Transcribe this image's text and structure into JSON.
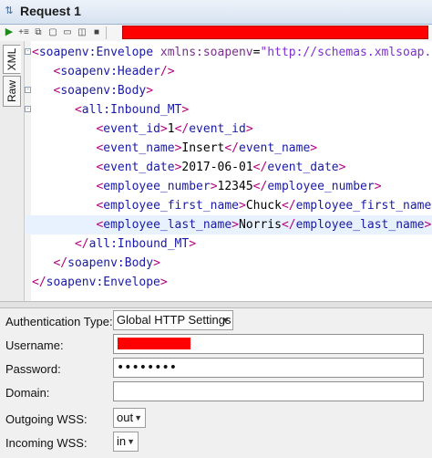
{
  "window": {
    "title": "Request 1",
    "app_icon": "soap-request-icon"
  },
  "toolbar": {
    "buttons": [
      "run-icon",
      "add-icon",
      "clone-icon",
      "format-icon",
      "close-icon",
      "options-icon",
      "stop-icon"
    ],
    "endpoint_redacted": true
  },
  "tabs": {
    "xml": "XML",
    "raw": "Raw",
    "active": "XML"
  },
  "editor": {
    "lines": [
      {
        "fold": "-",
        "segments": [
          {
            "c": "t",
            "s": "<"
          },
          {
            "c": "n",
            "s": "soapenv:Envelope"
          },
          {
            "c": "x",
            "s": " "
          },
          {
            "c": "a",
            "s": "xmlns:soapenv"
          },
          {
            "c": "x",
            "s": "="
          },
          {
            "c": "v",
            "s": "\"http://schemas.xmlsoap.org/soap/envelope/\""
          },
          {
            "c": "t",
            "s": ">"
          }
        ]
      },
      {
        "fold": "",
        "segments": [
          {
            "c": "x",
            "s": "   "
          },
          {
            "c": "t",
            "s": "<"
          },
          {
            "c": "n",
            "s": "soapenv:Header"
          },
          {
            "c": "t",
            "s": "/>"
          }
        ]
      },
      {
        "fold": "-",
        "segments": [
          {
            "c": "x",
            "s": "   "
          },
          {
            "c": "t",
            "s": "<"
          },
          {
            "c": "n",
            "s": "soapenv:Body"
          },
          {
            "c": "t",
            "s": ">"
          }
        ]
      },
      {
        "fold": "-",
        "segments": [
          {
            "c": "x",
            "s": "      "
          },
          {
            "c": "t",
            "s": "<"
          },
          {
            "c": "n",
            "s": "all:Inbound_MT"
          },
          {
            "c": "t",
            "s": ">"
          }
        ]
      },
      {
        "fold": "",
        "segments": [
          {
            "c": "x",
            "s": "         "
          },
          {
            "c": "t",
            "s": "<"
          },
          {
            "c": "n",
            "s": "event_id"
          },
          {
            "c": "t",
            "s": ">"
          },
          {
            "c": "x",
            "s": "1"
          },
          {
            "c": "t",
            "s": "</"
          },
          {
            "c": "n",
            "s": "event_id"
          },
          {
            "c": "t",
            "s": ">"
          }
        ]
      },
      {
        "fold": "",
        "segments": [
          {
            "c": "x",
            "s": "         "
          },
          {
            "c": "t",
            "s": "<"
          },
          {
            "c": "n",
            "s": "event_name"
          },
          {
            "c": "t",
            "s": ">"
          },
          {
            "c": "x",
            "s": "Insert"
          },
          {
            "c": "t",
            "s": "</"
          },
          {
            "c": "n",
            "s": "event_name"
          },
          {
            "c": "t",
            "s": ">"
          }
        ]
      },
      {
        "fold": "",
        "segments": [
          {
            "c": "x",
            "s": "         "
          },
          {
            "c": "t",
            "s": "<"
          },
          {
            "c": "n",
            "s": "event_date"
          },
          {
            "c": "t",
            "s": ">"
          },
          {
            "c": "x",
            "s": "2017-06-01"
          },
          {
            "c": "t",
            "s": "</"
          },
          {
            "c": "n",
            "s": "event_date"
          },
          {
            "c": "t",
            "s": ">"
          }
        ]
      },
      {
        "fold": "",
        "segments": [
          {
            "c": "x",
            "s": "         "
          },
          {
            "c": "t",
            "s": "<"
          },
          {
            "c": "n",
            "s": "employee_number"
          },
          {
            "c": "t",
            "s": ">"
          },
          {
            "c": "x",
            "s": "12345"
          },
          {
            "c": "t",
            "s": "</"
          },
          {
            "c": "n",
            "s": "employee_number"
          },
          {
            "c": "t",
            "s": ">"
          }
        ]
      },
      {
        "fold": "",
        "segments": [
          {
            "c": "x",
            "s": "         "
          },
          {
            "c": "t",
            "s": "<"
          },
          {
            "c": "n",
            "s": "employee_first_name"
          },
          {
            "c": "t",
            "s": ">"
          },
          {
            "c": "x",
            "s": "Chuck"
          },
          {
            "c": "t",
            "s": "</"
          },
          {
            "c": "n",
            "s": "employee_first_name"
          },
          {
            "c": "t",
            "s": ">"
          }
        ]
      },
      {
        "fold": "",
        "highlight": true,
        "segments": [
          {
            "c": "x",
            "s": "         "
          },
          {
            "c": "t",
            "s": "<"
          },
          {
            "c": "n",
            "s": "employee_last_name"
          },
          {
            "c": "t",
            "s": ">"
          },
          {
            "c": "x",
            "s": "Norris"
          },
          {
            "c": "t",
            "s": "</"
          },
          {
            "c": "n",
            "s": "employee_last_name"
          },
          {
            "c": "t",
            "s": ">"
          }
        ]
      },
      {
        "fold": "",
        "segments": [
          {
            "c": "x",
            "s": "      "
          },
          {
            "c": "t",
            "s": "</"
          },
          {
            "c": "n",
            "s": "all:Inbound_MT"
          },
          {
            "c": "t",
            "s": ">"
          }
        ]
      },
      {
        "fold": "",
        "segments": [
          {
            "c": "x",
            "s": "   "
          },
          {
            "c": "t",
            "s": "</"
          },
          {
            "c": "n",
            "s": "soapenv:Body"
          },
          {
            "c": "t",
            "s": ">"
          }
        ]
      },
      {
        "fold": "",
        "segments": [
          {
            "c": "t",
            "s": "</"
          },
          {
            "c": "n",
            "s": "soapenv:Envelope"
          },
          {
            "c": "t",
            "s": ">"
          }
        ]
      }
    ]
  },
  "auth": {
    "type_label": "Authentication Type:",
    "type_value": "Global HTTP Settings",
    "username_label": "Username:",
    "username_value_redacted": true,
    "password_label": "Password:",
    "password_value": "••••••••",
    "domain_label": "Domain:",
    "domain_value": "",
    "outgoing_label": "Outgoing WSS:",
    "outgoing_value": "out",
    "incoming_label": "Incoming WSS:",
    "incoming_value": "in"
  },
  "colors": {
    "tag": "#b4007f",
    "name": "#1a1aa6",
    "attr": "#7a2f8d",
    "value": "#7d2fd1",
    "redaction": "#ff0000",
    "highlight_line": "#e8f2fe"
  }
}
